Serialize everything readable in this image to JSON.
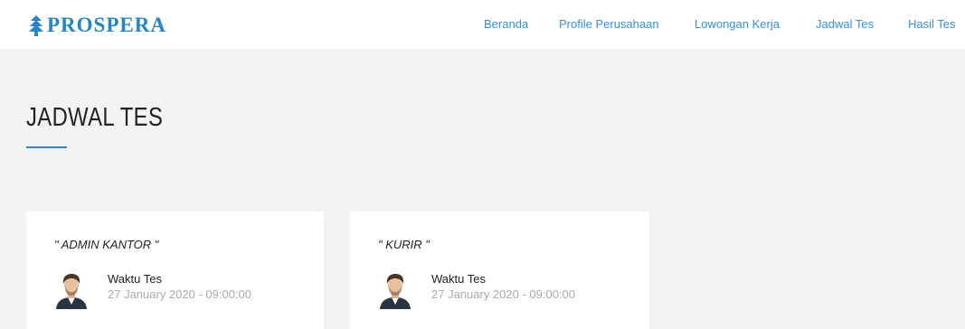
{
  "navbar": {
    "logo_text": "PROSPERA",
    "links": [
      "Beranda",
      "Profile Perusahaan",
      "Lowongan Kerja",
      "Jadwal Tes",
      "Hasil Tes"
    ]
  },
  "page": {
    "title": "JADWAL TES"
  },
  "cards": [
    {
      "title": "\" ADMIN KANTOR \"",
      "label": "Waktu Tes",
      "datetime": "27 January 2020 - 09:00:00"
    },
    {
      "title": "\" KURIR \"",
      "label": "Waktu Tes",
      "datetime": "27 January 2020 - 09:00:00"
    }
  ],
  "colors": {
    "brand": "#2585c6",
    "nav_link": "#3a8fd0",
    "background": "#f3f3f3",
    "accent_line": "#2f87c8"
  }
}
